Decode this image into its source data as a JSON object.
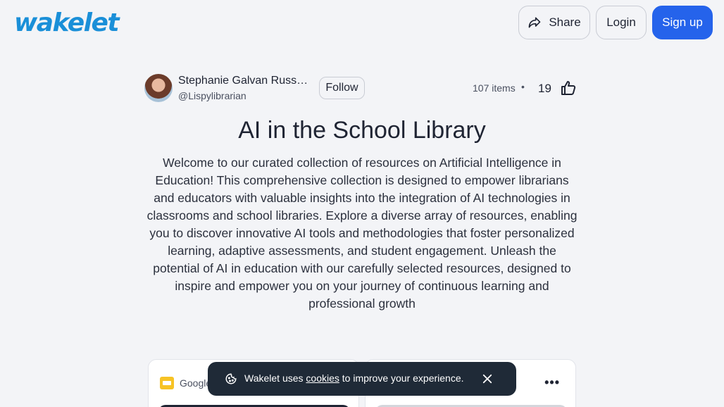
{
  "header": {
    "logo_text": "wakelet",
    "share_label": "Share",
    "login_label": "Login",
    "signup_label": "Sign up",
    "brand_color": "#1a8fd8",
    "accent_color": "#2563eb"
  },
  "author": {
    "name": "Stephanie Galvan Russell,...",
    "handle": "@Lispylibrarian",
    "follow_label": "Follow"
  },
  "stats": {
    "items": "107 items",
    "separator": "•",
    "likes": "19"
  },
  "collection": {
    "title": "AI in the School Library",
    "description": "Welcome to our curated collection of resources on Artificial Intelligence in Education! This comprehensive collection is designed to empower librarians and educators with valuable insights into the integration of AI technologies in classrooms and school libraries. Explore a diverse array of resources, enabling you to discover innovative AI tools and methodologies that foster personalized learning, adaptive assessments, and student engagement. Unleash the potential of AI in education with our carefully selected resources, designed to inspire and empower you on your journey of continuous learning and professional growth"
  },
  "cards": [
    {
      "source": "Google",
      "icon": "google-slides-icon"
    },
    {
      "source": "",
      "more": "•••"
    }
  ],
  "cookie_banner": {
    "prefix": "Wakelet uses ",
    "link": "cookies",
    "suffix": " to improve your experience."
  }
}
